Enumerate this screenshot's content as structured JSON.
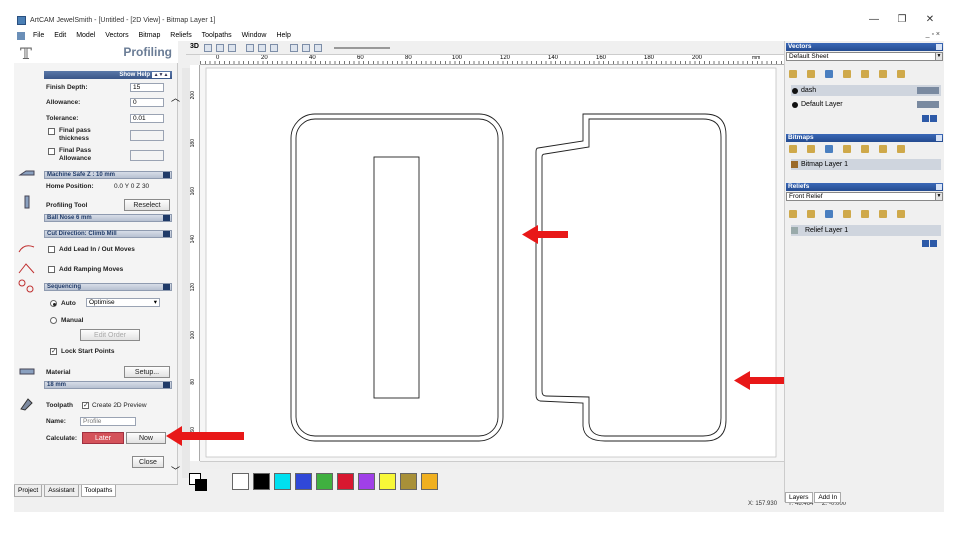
{
  "window": {
    "title": "ArtCAM JewelSmith - [Untitled - [2D View] - Bitmap Layer 1]",
    "controls": [
      "—",
      "❐",
      "✕"
    ],
    "mdi_controls": "_ ▫ ×"
  },
  "menu": [
    "File",
    "Edit",
    "Model",
    "Vectors",
    "Bitmap",
    "Reliefs",
    "Toolpaths",
    "Window",
    "Help"
  ],
  "profiling": {
    "title": "Profiling",
    "show_help": "Show Help",
    "show_help_mini": "▲▼▲",
    "finish_depth_label": "Finish Depth:",
    "finish_depth": "15",
    "allowance_label": "Allowance:",
    "allowance": "0",
    "tolerance_label": "Tolerance:",
    "tolerance": "0.01",
    "final_pass_thickness": "Final pass thickness",
    "final_pass_allowance": "Final Pass Allowance",
    "machine_safe_z": "Machine Safe Z : 10 mm",
    "home_position": "Home Position:",
    "home_position_value": "0.0 Y 0 Z 30",
    "profiling_tool": "Profiling Tool",
    "reselect": "Reselect",
    "tool_name": "Ball Nose 6 mm",
    "cut_direction": "Cut Direction: Climb Mill",
    "lead_in_out": "Add Lead In / Out Moves",
    "ramping": "Add Ramping Moves",
    "sequencing": "Sequencing",
    "auto": "Auto",
    "auto_value": "Optimise",
    "manual": "Manual",
    "edit_order": "Edit Order",
    "lock_start": "Lock Start Points",
    "material": "Material",
    "setup": "Setup...",
    "material_value": "18 mm",
    "toolpath": "Toolpath",
    "create_preview": "Create 2D Preview",
    "name_label": "Name:",
    "name_value": "Profile",
    "calculate_label": "Calculate:",
    "later": "Later",
    "now": "Now",
    "close": "Close"
  },
  "bottom_tabs": [
    "Project",
    "Assistant",
    "Toolpaths"
  ],
  "toolbar": {
    "btn3d": "3D"
  },
  "ruler": {
    "h_ticks": [
      "0",
      "20",
      "40",
      "60",
      "80",
      "100",
      "120",
      "140",
      "160",
      "180",
      "200"
    ],
    "h_unit": "mm",
    "v_ticks": [
      "200",
      "180",
      "160",
      "140",
      "120",
      "100",
      "80",
      "60",
      "40",
      "20",
      "0"
    ]
  },
  "palette_colors": [
    "#ffffff",
    "#000000",
    "#00e0f0",
    "#3048d8",
    "#40b040",
    "#d81830",
    "#a040e8",
    "#f8f838",
    "#a89038",
    "#f0b020"
  ],
  "status": {
    "x": "X: 157.930",
    "y": "Y: 48.464",
    "z": "Z: -0.000"
  },
  "vectors_panel": {
    "title": "Vectors",
    "sheet": "Default Sheet",
    "layers": [
      "dash",
      "Default Layer"
    ]
  },
  "bitmaps_panel": {
    "title": "Bitmaps",
    "layer": "Bitmap Layer 1"
  },
  "reliefs_panel": {
    "title": "Reliefs",
    "relief": "Front Relief",
    "layer": "Relief Layer 1"
  },
  "right_tabs": [
    "Layers",
    "Add In"
  ]
}
